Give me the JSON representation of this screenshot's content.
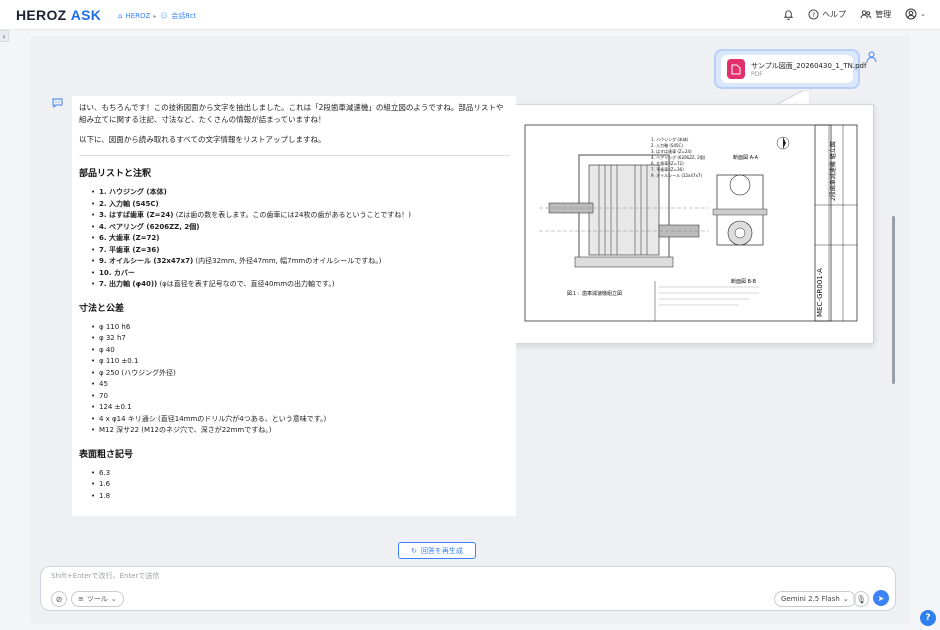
{
  "header": {
    "logo_main": "HEROZ",
    "logo_accent": "ASK",
    "breadcrumb": [
      {
        "icon": "home-icon",
        "label": "HEROZ"
      },
      {
        "icon": "chat-icon",
        "label": "会話8ct"
      }
    ],
    "help_label": "ヘルプ",
    "admin_label": "管理"
  },
  "attachment": {
    "file_name": "サンプル図面_20260430_1_TN.pdf",
    "file_type": "PDF"
  },
  "assistant": {
    "intro": "はい、もちろんです！この技術図面から文字を抽出しました。これは「2段歯車減速機」の組立図のようですね。部品リストや組み立てに関する注記、寸法など、たくさんの情報が詰まっていますね！",
    "intro2": "以下に、図面から読み取れるすべての文字情報をリストアップしますね。",
    "sections": [
      {
        "title": "部品リストと注釈",
        "items": [
          {
            "bold": "1. ハウジング (本体)",
            "text": ""
          },
          {
            "bold": "2. 入力軸 (S45C)",
            "text": ""
          },
          {
            "bold": "3. はすば歯車 (Z=24)",
            "text": " (Zは歯の数を表します。この歯車には24枚の歯があるということですね！)"
          },
          {
            "bold": "4. ベアリング (6206ZZ, 2個)",
            "text": ""
          },
          {
            "bold": "6. 大歯車 (Z=72)",
            "text": ""
          },
          {
            "bold": "7. 平歯車 (Z=36)",
            "text": ""
          },
          {
            "bold": "9. オイルシール (32x47x7)",
            "text": " (内径32mm, 外径47mm, 幅7mmのオイルシールですね。)"
          },
          {
            "bold": "10. カバー",
            "text": ""
          },
          {
            "bold": "7. 出力軸 (φ40))",
            "text": " (φは直径を表す記号なので、直径40mmの出力軸です。)"
          }
        ]
      },
      {
        "title": "寸法と公差",
        "items": [
          {
            "bold": "",
            "text": "φ 110 h6"
          },
          {
            "bold": "",
            "text": "φ 32 h7"
          },
          {
            "bold": "",
            "text": "φ 40"
          },
          {
            "bold": "",
            "text": "φ 110 ±0.1"
          },
          {
            "bold": "",
            "text": "φ 250 (ハウジング外径)"
          },
          {
            "bold": "",
            "text": "45"
          },
          {
            "bold": "",
            "text": "70"
          },
          {
            "bold": "",
            "text": "124 ±0.1"
          },
          {
            "bold": "",
            "text": "4 x φ14 キリ通シ (直径14mmのドリル穴が4つある、という意味です。)"
          },
          {
            "bold": "",
            "text": "M12 深サ22 (M12のネジ穴で、深さが22mmですね。)"
          }
        ]
      },
      {
        "title": "表面粗さ記号",
        "items": [
          {
            "bold": "",
            "text": "6.3"
          },
          {
            "bold": "",
            "text": "1.6"
          },
          {
            "bold": "",
            "text": "1.8"
          }
        ]
      }
    ]
  },
  "preview": {
    "parts_list": [
      "1. ハウジング (本体)",
      "2. 入力軸 (S45C)",
      "3. はすば歯車 (Z=24)",
      "4. ベアリング (6206ZZ, 2個)",
      "6. 大歯車 (Z=72)",
      "7. 平歯車 (Z=36)",
      "9. オイルシール (32x47x7)"
    ],
    "fig_caption": "図１：歯車減速機組立図",
    "section_label": "断面図 A-A",
    "section_label2": "断面図 B-B",
    "drawing_no": "MEC-GR001-A",
    "title_block": "2段歯車減速機 組立図"
  },
  "composer": {
    "regenerate_label": "回答を再生成",
    "placeholder": "Shift+Enterで改行、Enterで送信",
    "value": "",
    "tools_label": "ツール",
    "model_label": "Gemini 2.5 Flash"
  }
}
